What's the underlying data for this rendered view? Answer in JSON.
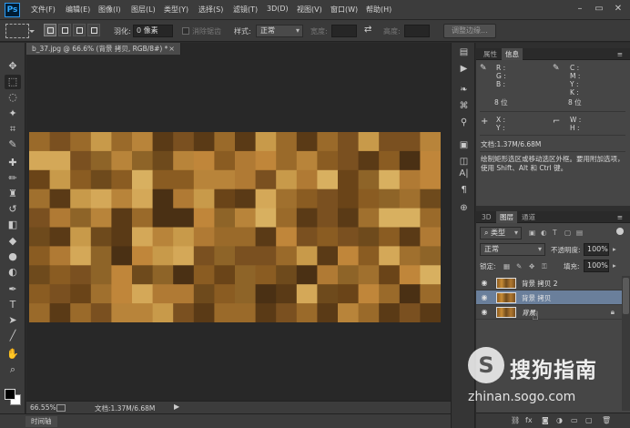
{
  "app": {
    "logo": "Ps"
  },
  "menu": [
    "文件(F)",
    "编辑(E)",
    "图像(I)",
    "图层(L)",
    "类型(Y)",
    "选择(S)",
    "滤镜(T)",
    "3D(D)",
    "视图(V)",
    "窗口(W)",
    "帮助(H)"
  ],
  "options": {
    "feather_label": "羽化:",
    "feather_value": "0 像素",
    "antialias_label": "消除锯齿",
    "style_label": "样式:",
    "style_value": "正常",
    "width_label": "宽度:",
    "height_label": "高度:",
    "refine_edge_label": "调整边缘..."
  },
  "document": {
    "tab_title": "b_37.jpg @ 66.6% (背景 拷贝, RGB/8#) *",
    "close": "×",
    "zoom": "66.55%",
    "doc_size": "文档:1.37M/6.68M"
  },
  "timeline": {
    "label": "时间轴"
  },
  "info_panel": {
    "tabs": [
      "属性",
      "信息"
    ],
    "active_tab": "信息",
    "rgb": {
      "r": "R :",
      "g": "G :",
      "b": "B :",
      "bits": "8 位"
    },
    "cmyk": {
      "c": "C :",
      "m": "M :",
      "y": "Y :",
      "k": "K :",
      "bits": "8 位"
    },
    "xy": {
      "x": "X :",
      "y": "Y :"
    },
    "wh": {
      "w": "W :",
      "h": "H :"
    },
    "doc_size": "文档:1.37M/6.68M",
    "help": "绘制矩形选区或移动选区外框。要用附加选项，使用 Shift、Alt 和 Ctrl 键。"
  },
  "layers_panel": {
    "tabs": [
      "3D",
      "图层",
      "通道"
    ],
    "active_tab": "图层",
    "filter_kind": "类型",
    "blend_mode": "正常",
    "opacity_label": "不透明度:",
    "opacity_value": "100%",
    "lock_label": "锁定:",
    "fill_label": "填充:",
    "fill_value": "100%",
    "layers": [
      {
        "name": "背景 拷贝 2",
        "selected": false,
        "locked": false
      },
      {
        "name": "背景 拷贝",
        "selected": true,
        "locked": false
      },
      {
        "name": "背景",
        "selected": false,
        "locked": true
      }
    ]
  },
  "watermark": {
    "logo": "S",
    "title": "搜狗指南",
    "url": "zhinan.sogo.com"
  },
  "colors": {
    "accent": "#31a8ff",
    "selected_layer": "#6a7f9b",
    "panel": "#464646"
  }
}
